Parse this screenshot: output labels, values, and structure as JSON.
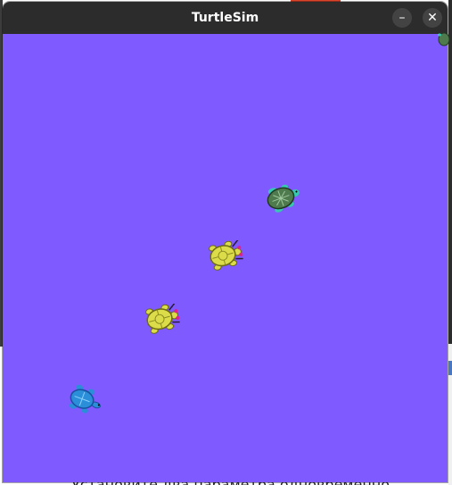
{
  "window": {
    "title": "TurtleSim",
    "minimize_icon": "minimize-icon",
    "close_icon": "close-icon",
    "minimize_glyph": "–",
    "close_glyph": "✕"
  },
  "canvas": {
    "background": "#7f5aff"
  },
  "turtles": [
    {
      "name": "turtle-green",
      "color": "#4e7a4e",
      "accent": "#36c9b0"
    },
    {
      "name": "turtle-yellow-1",
      "color": "#dcdc4a",
      "accent": "#e0208c"
    },
    {
      "name": "turtle-yellow-2",
      "color": "#dcdc4a",
      "accent": "#e0208c"
    },
    {
      "name": "turtle-blue",
      "color": "#2a8ed8",
      "accent": "#1a4fa0"
    }
  ],
  "background": {
    "bottom_text": "Установите два параметра одновременно..."
  }
}
